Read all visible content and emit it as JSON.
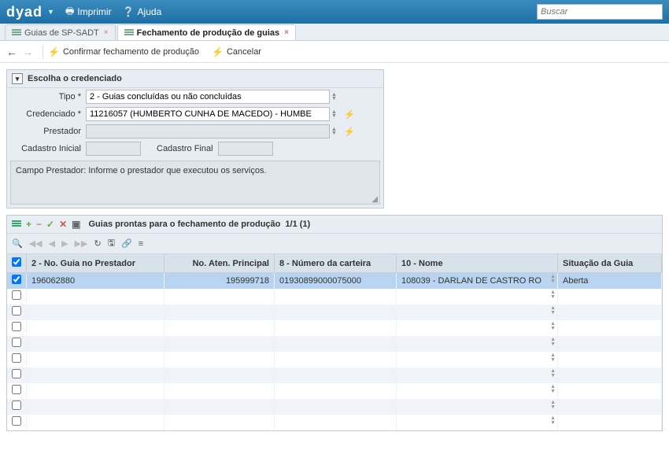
{
  "topbar": {
    "logo": "dyad",
    "print": "Imprimir",
    "help": "Ajuda",
    "search_placeholder": "Buscar"
  },
  "tabs": [
    {
      "label": "Guias de SP-SADT",
      "active": false
    },
    {
      "label": "Fechamento de produção de guias",
      "active": true
    }
  ],
  "actions": {
    "confirm": "Confirmar fechamento de produção",
    "cancel": "Cancelar"
  },
  "form": {
    "title": "Escolha o credenciado",
    "tipo_label": "Tipo *",
    "tipo_value": "2 - Guias concluídas ou não concluídas",
    "cred_label": "Credenciado *",
    "cred_value": "11216057 (HUMBERTO CUNHA DE MACEDO) - HUMBE",
    "prest_label": "Prestador",
    "prest_value": "",
    "cad_ini_label": "Cadastro Inicial",
    "cad_ini_value": "",
    "cad_fin_label": "Cadastro Final",
    "cad_fin_value": "",
    "help_text": "Campo Prestador: Informe o prestador que executou os serviços."
  },
  "grid": {
    "title": "Guias prontas para o fechamento de produção",
    "count": "1/1 (1)",
    "columns": {
      "c1": "2 - No. Guia no Prestador",
      "c2": "No. Aten. Principal",
      "c3": "8 - Número da carteira",
      "c4": "10 - Nome",
      "c5": "Situação da Guia"
    },
    "rows": [
      {
        "checked": true,
        "c1": "196062880",
        "c2": "195999718",
        "c3": "01930899000075000",
        "c4": "108039 - DARLAN DE CASTRO RO",
        "c5": "Aberta"
      }
    ]
  }
}
